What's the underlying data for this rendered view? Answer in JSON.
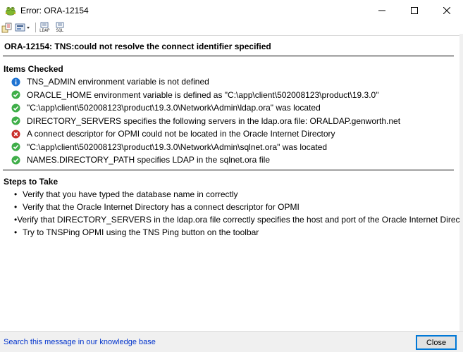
{
  "window": {
    "title": "Error: ORA-12154",
    "controls": [
      "minimize",
      "maximize",
      "close"
    ]
  },
  "toolbar": {
    "items": [
      {
        "icon": "cut-paste-icon"
      },
      {
        "icon": "settings-dropdown-icon"
      },
      {
        "icon": "ldap-icon",
        "text": "LDAP"
      },
      {
        "icon": "sql-icon",
        "text": "SQL"
      }
    ]
  },
  "error": {
    "heading": "ORA-12154: TNS:could not resolve the connect identifier specified"
  },
  "items_checked": {
    "heading": "Items Checked",
    "items": [
      {
        "status": "info",
        "text": "TNS_ADMIN environment variable is not defined"
      },
      {
        "status": "ok",
        "text": "ORACLE_HOME environment variable is defined as \"C:\\app\\client\\502008123\\product\\19.3.0\""
      },
      {
        "status": "ok",
        "text": "\"C:\\app\\client\\502008123\\product\\19.3.0\\Network\\Admin\\ldap.ora\" was located"
      },
      {
        "status": "ok",
        "text": "DIRECTORY_SERVERS specifies the following servers in the ldap.ora file: ORALDAP.genworth.net"
      },
      {
        "status": "error",
        "text": "A connect descriptor for OPMI could not be located in the Oracle Internet Directory"
      },
      {
        "status": "ok",
        "text": "\"C:\\app\\client\\502008123\\product\\19.3.0\\Network\\Admin\\sqlnet.ora\" was located"
      },
      {
        "status": "ok",
        "text": "NAMES.DIRECTORY_PATH specifies LDAP in the sqlnet.ora file"
      }
    ]
  },
  "steps": {
    "heading": "Steps to Take",
    "items": [
      "Verify that you have typed the database name in correctly",
      "Verify that the Oracle Internet Directory has a connect descriptor for OPMI",
      "Verify that DIRECTORY_SERVERS in the ldap.ora file correctly specifies the host and port of the Oracle Internet Directory.",
      "Try to TNSPing OPMI using the TNS Ping button on the toolbar"
    ]
  },
  "footer": {
    "link_text": "Search this message in our knowledge base",
    "close_label": "Close"
  },
  "colors": {
    "ok": "#3fae49",
    "info": "#1e73d2",
    "error": "#c9302c",
    "link": "#0033cc",
    "focus": "#0078d7"
  }
}
